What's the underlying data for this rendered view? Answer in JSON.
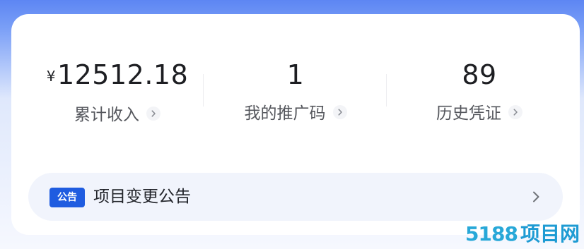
{
  "stats": [
    {
      "currency": "¥",
      "value": "12512.18",
      "label": "累计收入"
    },
    {
      "value": "1",
      "label": "我的推广码"
    },
    {
      "value": "89",
      "label": "历史凭证"
    }
  ],
  "notice": {
    "badge": "公告",
    "text": "项目变更公告"
  },
  "watermark": {
    "digits": "5188",
    "text": "项目网"
  },
  "colors": {
    "accent": "#1f5ce0",
    "text_primary": "#1d1e22",
    "text_secondary": "#55575d",
    "notice_bg": "#f1f4fc"
  },
  "icons": {
    "stat_chevron": "chevron-right-icon",
    "notice_chevron": "chevron-right-icon"
  }
}
